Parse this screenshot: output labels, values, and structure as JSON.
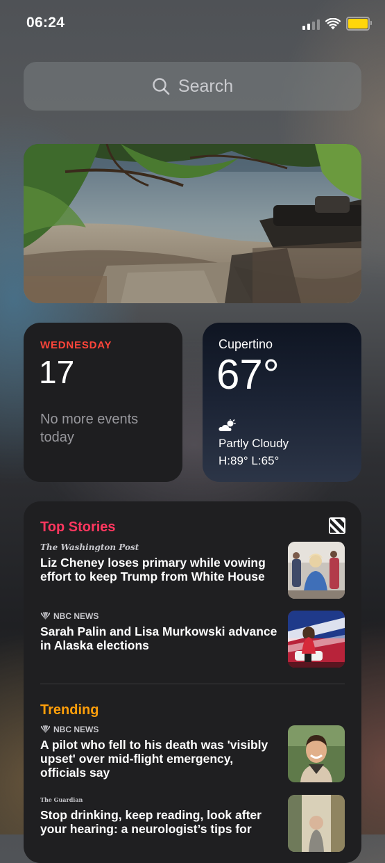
{
  "status_bar": {
    "time": "06:24",
    "battery_color": "#ffd60a"
  },
  "search": {
    "label": "Search",
    "icon": "search-icon"
  },
  "photo_widget": {
    "icon": "photo-image"
  },
  "calendar": {
    "day": "WEDNESDAY",
    "date": "17",
    "events": "No more events today",
    "accent": "#ff453a"
  },
  "weather": {
    "city": "Cupertino",
    "temp": "67°",
    "condition": "Partly Cloudy",
    "hilo": "H:89° L:65°",
    "icon": "partly-cloudy-icon"
  },
  "news": {
    "top_stories_title": "Top Stories",
    "trending_title": "Trending",
    "top_color": "#ff375f",
    "trending_color": "#ff9f0a",
    "stories": [
      {
        "source": "The Washington Post",
        "headline": "Liz Cheney loses primary while vowing effort to keep Trump from White House"
      },
      {
        "source": "NBC NEWS",
        "headline": "Sarah Palin and Lisa Murkowski advance in Alaska elections"
      }
    ],
    "trending": [
      {
        "source": "NBC NEWS",
        "headline": "A pilot who fell to his death was 'visibly upset' over mid-flight emergency, officials say"
      },
      {
        "source": "The Guardian",
        "headline": "Stop drinking, keep reading, look after your hearing: a neurologist’s tips for"
      }
    ]
  }
}
